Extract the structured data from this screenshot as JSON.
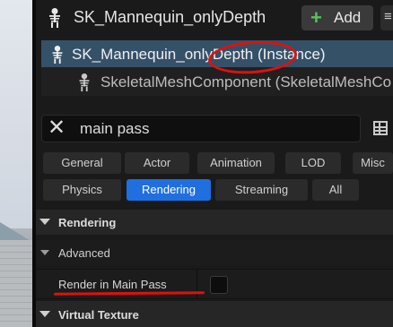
{
  "header": {
    "title": "SK_Mannequin_onlyDepth",
    "add_label": "Add",
    "add_icon": "plus-icon",
    "plus_glyph": "+",
    "extra_glyph": "≡"
  },
  "tree": {
    "items": [
      {
        "label": "SK_Mannequin_onlyDepth (Instance)",
        "icon": "skeleton-icon",
        "selected": true
      },
      {
        "label": "SkeletalMeshComponent (SkeletalMeshCo",
        "icon": "skeleton-icon",
        "selected": false
      }
    ]
  },
  "search": {
    "value": "main pass",
    "clear_glyph": "✕"
  },
  "categories": {
    "row1": [
      "General",
      "Actor",
      "Animation",
      "LOD",
      "Misc"
    ],
    "row2": [
      "Physics",
      "Rendering",
      "Streaming",
      "All"
    ],
    "active": "Rendering",
    "active_color": "#1f6fe0"
  },
  "details": {
    "section_rendering": "Rendering",
    "subsection_advanced": "Advanced",
    "property_label": "Render in Main Pass",
    "property_checked": false,
    "section_virtual_texture": "Virtual Texture"
  },
  "annotation_color": "#e01010"
}
